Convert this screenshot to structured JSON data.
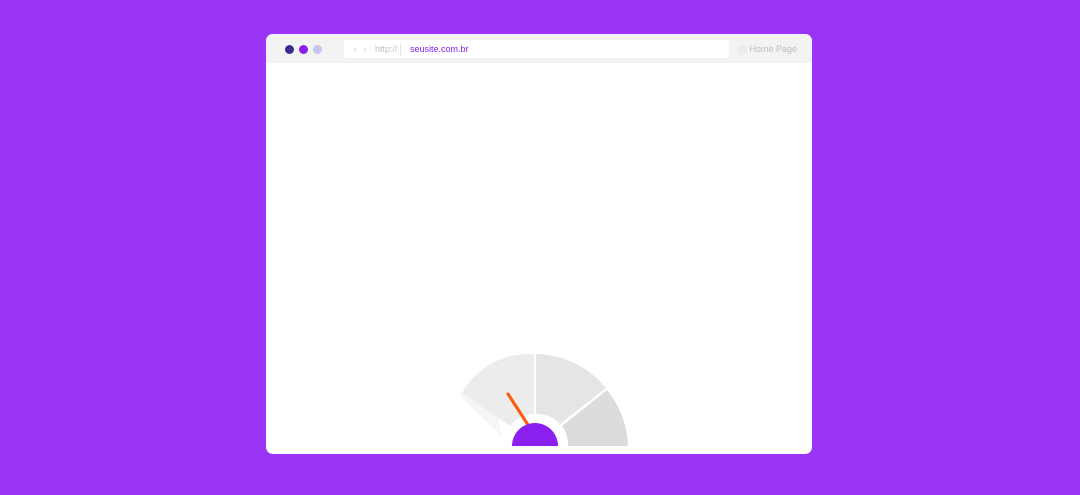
{
  "window": {
    "controls": [
      "close",
      "minimize",
      "maximize"
    ]
  },
  "address_bar": {
    "nav_arrows": "‹ ›",
    "protocol": "http://",
    "url": "seusite.com.br"
  },
  "toolbar": {
    "home_label": "Home Page"
  },
  "colors": {
    "background": "#9b35f5",
    "accent": "#8a1ff0",
    "needle": "#ff5a0a",
    "gauge_segment_light": "#ececec",
    "gauge_segment_dark": "#dcdcdc"
  },
  "speed_gauge": {
    "segments": 4,
    "level": 0.3
  }
}
